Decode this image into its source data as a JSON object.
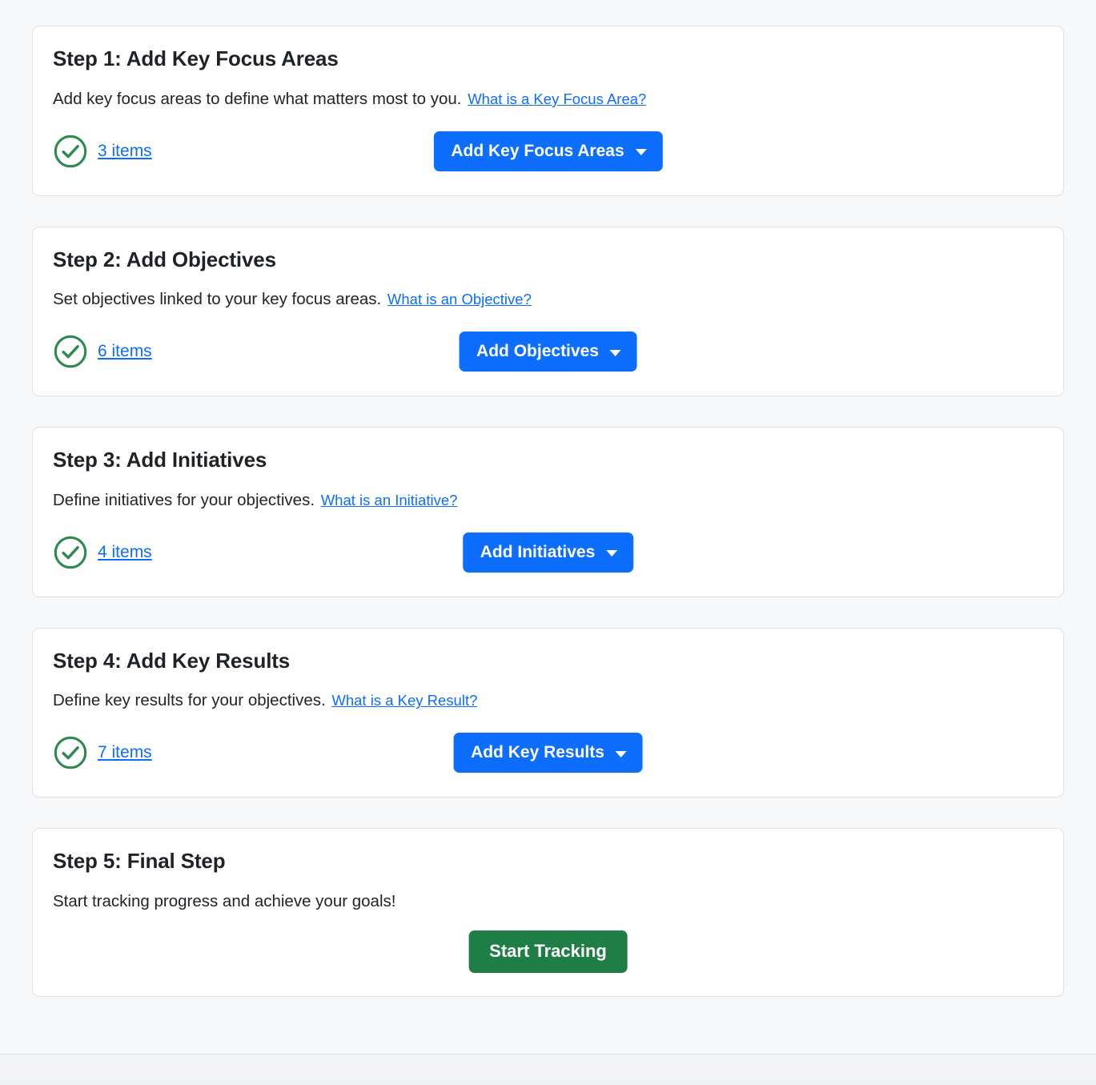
{
  "theme": {
    "page_bg": "#f7f8fa",
    "card_bg": "#ffffff",
    "card_border": "#dfe1e5",
    "primary": "#0d6efd",
    "success": "#1e7e45",
    "check_green": "#2f8a52",
    "heading_color": "#1f2328",
    "link_color": "#0d6efd"
  },
  "steps": [
    {
      "title": "Step 1: Add Key Focus Areas",
      "description": "Add key focus areas to define what matters most to you.",
      "help_link": "What is a Key Focus Area?",
      "status_icon": "check-circle-icon",
      "items_label": "3 items",
      "item_count": 3,
      "button_label": "Add Key Focus Areas",
      "button_icon": "chevron-down-icon",
      "button_variant": "primary"
    },
    {
      "title": "Step 2: Add Objectives",
      "description": "Set objectives linked to your key focus areas.",
      "help_link": "What is an Objective?",
      "status_icon": "check-circle-icon",
      "items_label": "6 items",
      "item_count": 6,
      "button_label": "Add Objectives",
      "button_icon": "chevron-down-icon",
      "button_variant": "primary"
    },
    {
      "title": "Step 3: Add Initiatives",
      "description": "Define initiatives for your objectives.",
      "help_link": "What is an Initiative?",
      "status_icon": "check-circle-icon",
      "items_label": "4 items",
      "item_count": 4,
      "button_label": "Add Initiatives",
      "button_icon": "chevron-down-icon",
      "button_variant": "primary"
    },
    {
      "title": "Step 4: Add Key Results",
      "description": "Define key results for your objectives.",
      "help_link": "What is a Key Result?",
      "status_icon": "check-circle-icon",
      "items_label": "7 items",
      "item_count": 7,
      "button_label": "Add Key Results",
      "button_icon": "chevron-down-icon",
      "button_variant": "primary"
    }
  ],
  "final_step": {
    "title": "Step 5: Final Step",
    "description": "Start tracking progress and achieve your goals!",
    "button_label": "Start Tracking",
    "button_variant": "success"
  }
}
